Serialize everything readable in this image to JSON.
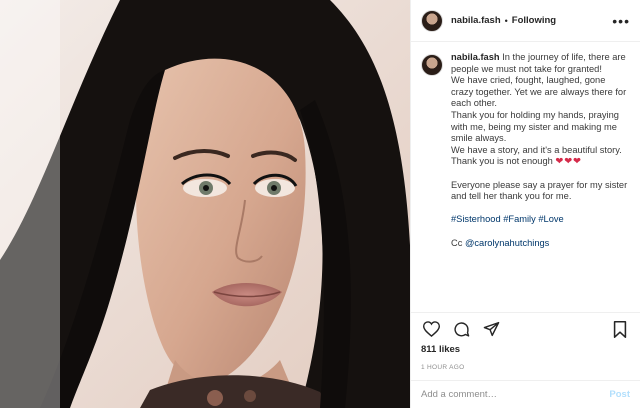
{
  "post": {
    "username": "nabila.fash",
    "separator": "•",
    "follow_status": "Following",
    "more_label": "•••",
    "image_alt": "Selfie photo",
    "caption": {
      "username": "nabila.fash",
      "lines": [
        "In the journey of life, there are people we must not take for granted!",
        "We have cried, fought, laughed, gone crazy together. Yet we are always there for each other.",
        "Thank you for holding my hands, praying with me, being my sister and making me smile always.",
        "We have a story, and it's a beautiful story.",
        "Thank you is not enough"
      ],
      "hearts": "❤❤❤",
      "prayer": "Everyone please say a prayer for my sister and tell her thank you for me.",
      "hashtags": [
        "#Sisterhood",
        "#Family",
        "#Love"
      ],
      "cc_prefix": "Cc ",
      "cc_mention": "@carolynahutchings"
    },
    "likes": "811 likes",
    "time": "1 HOUR AGO",
    "comment_placeholder": "Add a comment…",
    "post_button": "Post"
  },
  "icons": {
    "like": "heart-icon",
    "comment": "comment-icon",
    "share": "share-icon",
    "save": "bookmark-icon",
    "more": "more-icon"
  },
  "colors": {
    "link": "#00376b",
    "post_button_disabled": "#b2dffc",
    "muted": "#8e8e8e",
    "hearts": "#d52b4a"
  }
}
